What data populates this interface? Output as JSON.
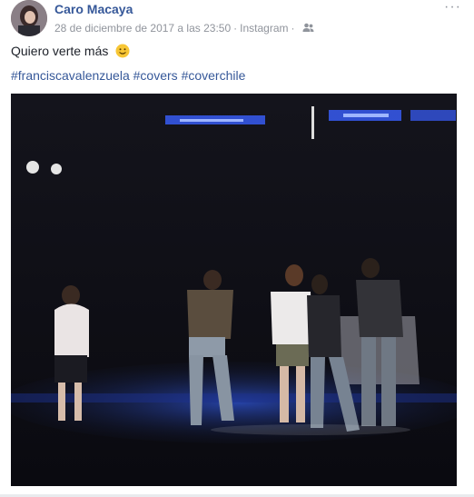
{
  "post": {
    "author": "Caro Macaya",
    "timestamp": "28 de diciembre de 2017 a las 23:50",
    "separator": "·",
    "source": "Instagram",
    "audience_icon": "friends-icon",
    "menu_label": "···",
    "text": "Quiero verte más",
    "emoji_icon": "smile-emoji-icon",
    "hashtags": [
      "#franciscavalenzuela",
      "#covers",
      "#coverchile"
    ]
  },
  "colors": {
    "link": "#365899",
    "meta": "#90949c",
    "text": "#1d2129",
    "stage_light": "#2a5cff"
  }
}
